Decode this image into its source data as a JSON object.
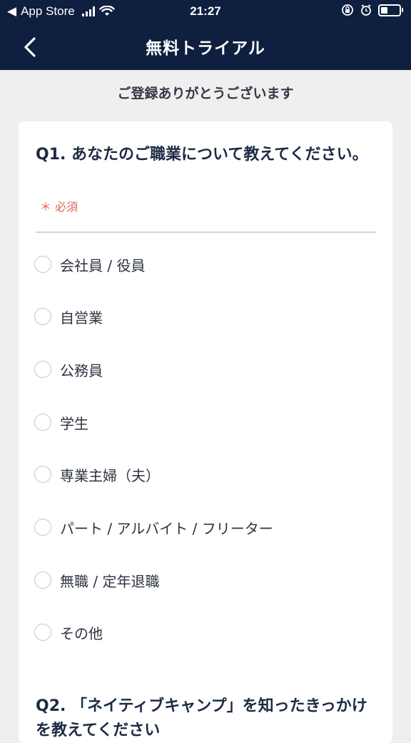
{
  "status_bar": {
    "back_app": "App Store",
    "time": "21:27"
  },
  "nav": {
    "title": "無料トライアル"
  },
  "subtitle": "ご登録ありがとうございます",
  "question1": {
    "text": "Q1. あなたのご職業について教えてください。",
    "required": "＊ 必須",
    "options": [
      "会社員 / 役員",
      "自営業",
      "公務員",
      "学生",
      "専業主婦（夫）",
      "パート / アルバイト / フリーター",
      "無職 / 定年退職",
      "その他"
    ]
  },
  "question2": {
    "text": "Q2. 「ネイティブキャンプ」を知ったきっかけを教えてください"
  },
  "colors": {
    "header_bg": "#0e1f3f",
    "required": "#e0645a",
    "page_bg": "#efefef"
  }
}
